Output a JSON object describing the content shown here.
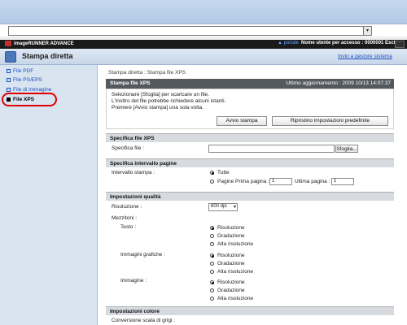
{
  "header": {
    "brand": "imageRUNNER ADVANCE",
    "portal_link": "▲ portale",
    "user_label": "Nome utente per accesso : 0000001 Esci"
  },
  "page": {
    "title": "Stampa diretta",
    "admin_link": "Invio a gestore sistema",
    "breadcrumb": "Stampa diretta : Stampa file XPS"
  },
  "sidebar": {
    "items": [
      {
        "label": "File PDF"
      },
      {
        "label": "File PS/EPS"
      },
      {
        "label": "File di immagine"
      },
      {
        "label": "File XPS"
      }
    ]
  },
  "panel": {
    "title": "Stampa file XPS",
    "updated": "Ultimo aggiornamento : 2009 10/13 14:07:37",
    "info": [
      "Selezionare [Sfoglia] per scaricare un file.",
      "L'inoltro del file potrebbe richiedere alcuni istanti.",
      "Premere [Avvio stampa] una sola volta."
    ],
    "start_button": "Avvio stampa",
    "reset_button": "Ripristino impostazioni predefinite"
  },
  "file_spec": {
    "header": "Specifica file XPS",
    "label": "Specifica file :",
    "browse_button": "Sfoglia..."
  },
  "page_range": {
    "header": "Specifica intervallo pagine",
    "label": "Intervallo stampa :",
    "opt_all": "Tutte",
    "opt_pages": "Pagine Prima pagina :",
    "first_value": "1",
    "last_label": "Ultima pagina :",
    "last_value": "1"
  },
  "quality": {
    "header": "Impostazioni qualità",
    "resolution_label": "Risoluzione :",
    "resolution_value": "600 dpi",
    "halftone_label": "Mezzitoni :",
    "text_label": "Testo :",
    "graphics_label": "Immagini grafiche :",
    "image_label": "Immagine :",
    "options": [
      "Risoluzione",
      "Gradazione",
      "Alta risoluzione"
    ]
  },
  "color": {
    "header": "Impostazioni colore",
    "gray_label": "Conversione scala di grigi :"
  }
}
